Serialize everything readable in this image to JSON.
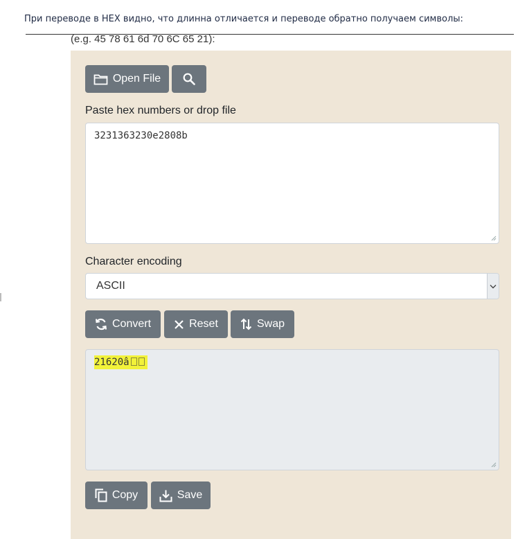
{
  "intro_text": "При переводе в HEX видно, что длинна отличается и переводе обратно получаем символы:",
  "example_text": "(e.g. 45 78 61 6d 70 6C 65 21):",
  "toolbar": {
    "open_file_label": "Open File",
    "search_icon": "search-icon",
    "folder_icon": "folder-icon"
  },
  "input": {
    "label": "Paste hex numbers or drop file",
    "value": "3231363230e2808b"
  },
  "encoding": {
    "label": "Character encoding",
    "selected": "ASCII"
  },
  "actions": {
    "convert_label": "Convert",
    "reset_label": "Reset",
    "swap_label": "Swap"
  },
  "output": {
    "value": "21620â",
    "highlight_color": "#f2f23a"
  },
  "bottom": {
    "copy_label": "Copy",
    "save_label": "Save"
  },
  "colors": {
    "panel": "#efe6d7",
    "button": "#6c757d",
    "output_bg": "#e9ecef"
  }
}
